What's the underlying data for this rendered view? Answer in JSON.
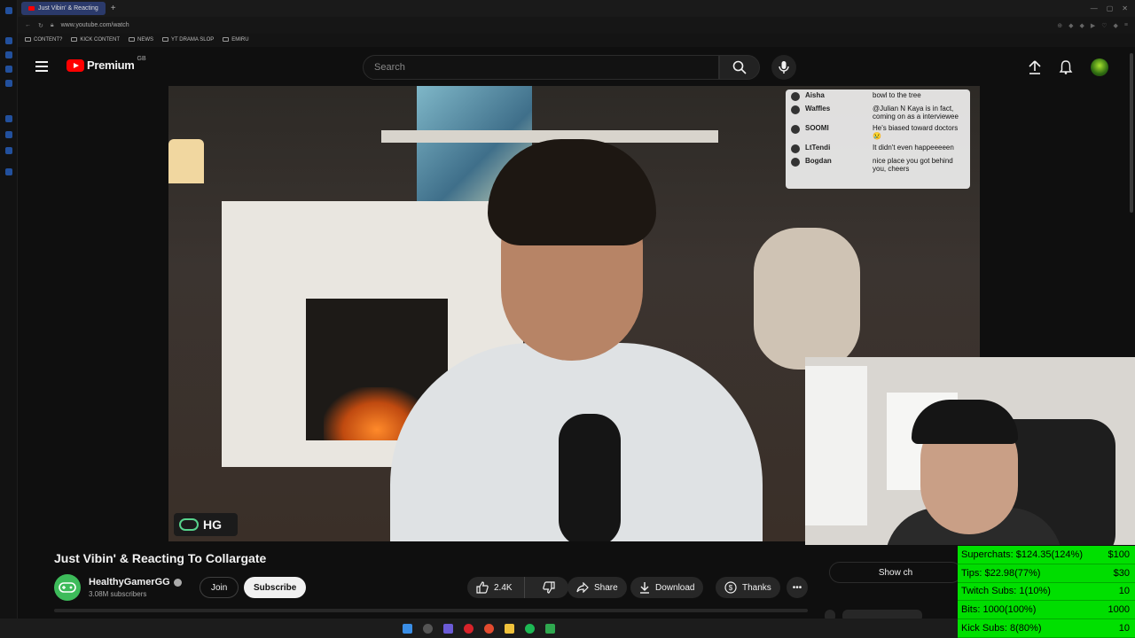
{
  "browser": {
    "tab_title": "Just Vibin' & Reacting",
    "url": "www.youtube.com/watch",
    "bookmarks": [
      "CONTENT?",
      "KICK CONTENT",
      "NEWS",
      "YT DRAMA SLOP",
      "EMIRU"
    ]
  },
  "header": {
    "logo_text": "Premium",
    "region": "GB",
    "search_placeholder": "Search"
  },
  "video": {
    "watermark": "HG",
    "chat_overlay": [
      {
        "name": "Aisha",
        "message": "bowl to the tree"
      },
      {
        "name": "Waffles",
        "message": "@Julian N Kaya is in fact, coming on as a interviewee"
      },
      {
        "name": "SOOMI",
        "message": "He's biased toward doctors 😢"
      },
      {
        "name": "LtTendi",
        "message": "It didn't even happeeeeen"
      },
      {
        "name": "Bogdan",
        "message": "nice place you got behind you, cheers"
      }
    ]
  },
  "meta": {
    "title": "Just Vibin' & Reacting To Collargate",
    "channel": "HealthyGamerGG",
    "subscribers": "3.08M subscribers",
    "join_label": "Join",
    "subscribe_label": "Subscribe",
    "like_count": "2.4K",
    "share_label": "Share",
    "download_label": "Download",
    "thanks_label": "Thanks",
    "show_chat_label": "Show ch"
  },
  "stats": [
    {
      "label": "Superchats: $124.35(124%)",
      "goal": "$100"
    },
    {
      "label": "Tips:  $22.98(77%)",
      "goal": "$30"
    },
    {
      "label": "Twitch Subs: 1(10%)",
      "goal": "10"
    },
    {
      "label": "Bits:  1000(100%)",
      "goal": "1000"
    },
    {
      "label": "Kick Subs:  8(80%)",
      "goal": "10"
    }
  ],
  "colors": {
    "brand_red": "#ff0000",
    "stats_green": "#00dd00",
    "background": "#0f0f0f"
  }
}
